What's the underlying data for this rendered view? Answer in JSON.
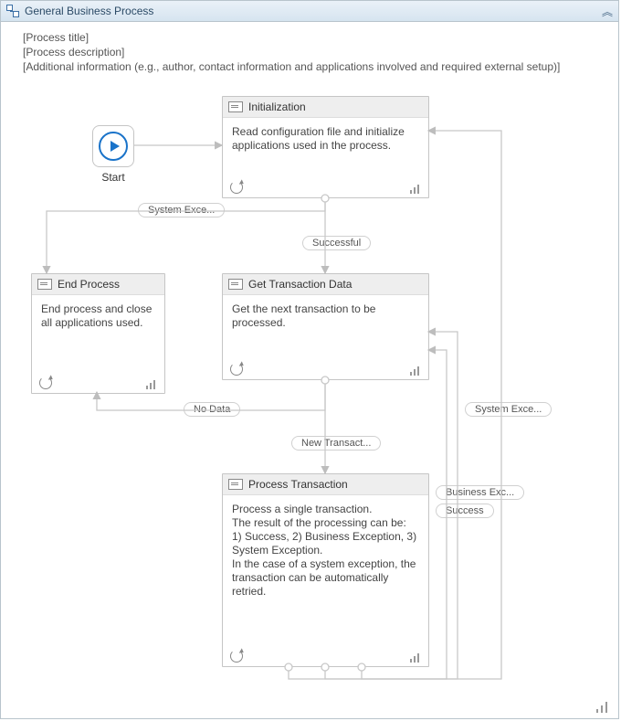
{
  "panel": {
    "title": "General Business Process"
  },
  "meta": {
    "line1": "[Process title]",
    "line2": "[Process description]",
    "line3": "[Additional information (e.g., author, contact information and applications involved and required external setup)]"
  },
  "start": {
    "label": "Start"
  },
  "nodes": {
    "init": {
      "title": "Initialization",
      "body": "Read configuration file and initialize applications used in the process."
    },
    "end": {
      "title": "End Process",
      "body": "End process and close all applications used."
    },
    "get": {
      "title": "Get Transaction Data",
      "body": "Get the next transaction to be processed."
    },
    "proc": {
      "title": "Process Transaction",
      "body": "Process a single transaction.\nThe result of the processing can be:\n1) Success, 2) Business Exception, 3) System Exception.\nIn the case of a system exception, the transaction can be automatically retried."
    }
  },
  "edges": {
    "system_exce_left": "System Exce...",
    "successful": "Successful",
    "no_data": "No Data",
    "new_transact": "New Transact...",
    "system_exce_right": "System Exce...",
    "business_exc": "Business Exc...",
    "success": "Success"
  }
}
